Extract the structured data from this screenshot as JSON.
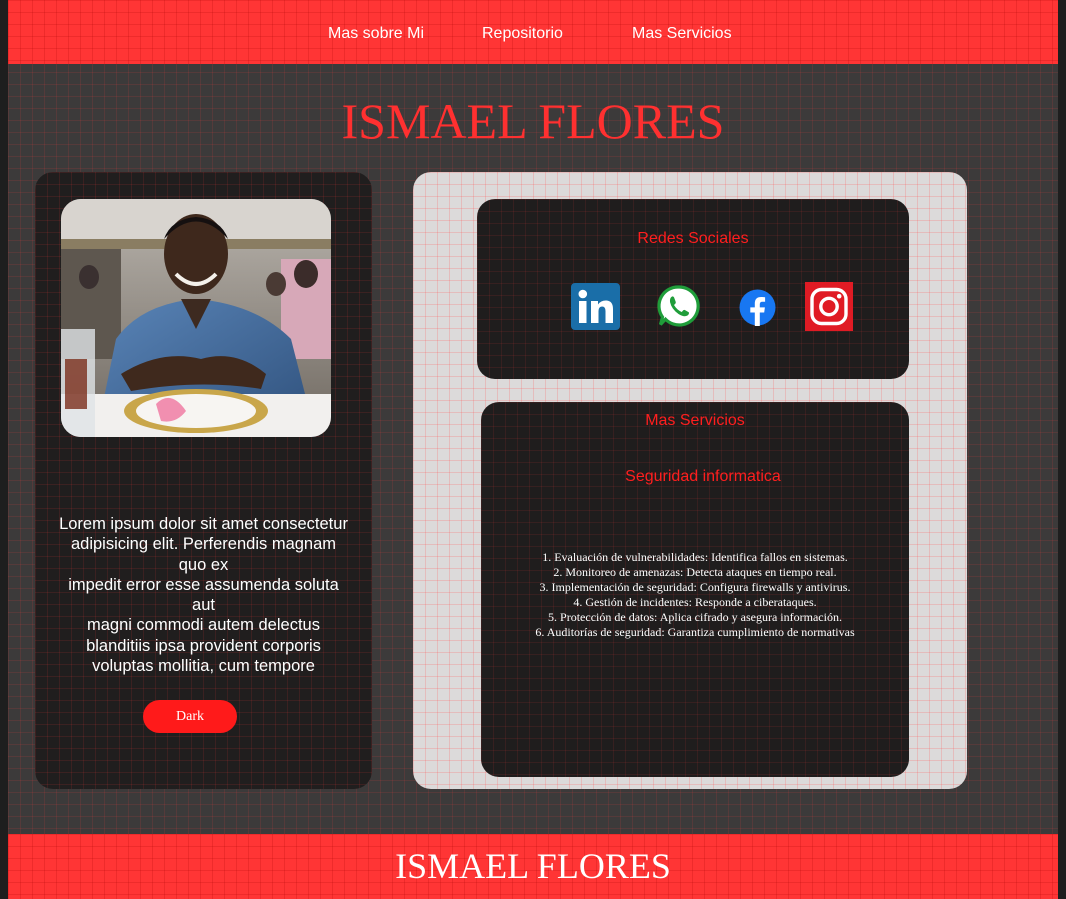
{
  "colors": {
    "accent": "#ff3535",
    "title_red": "#ff3030",
    "page_background": "#3c3a3a",
    "card_dark": "#201e1e",
    "panel_light": "#dcdada",
    "button_red": "#ff1a1a"
  },
  "nav": {
    "items": [
      {
        "label": "Mas sobre Mi"
      },
      {
        "label": "Repositorio"
      },
      {
        "label": "Mas Servicios"
      }
    ]
  },
  "header": {
    "title": "ISMAEL FLORES"
  },
  "profile": {
    "photo_icon": "profile-photo",
    "bio_lines": [
      "Lorem ipsum dolor sit amet consectetur",
      "adipisicing elit. Perferendis magnam",
      "quo ex",
      "impedit error esse assumenda soluta",
      "aut",
      "magni commodi autem delectus",
      "blanditiis ipsa provident corporis",
      "voluptas mollitia, cum tempore"
    ],
    "theme_button_label": "Dark"
  },
  "social": {
    "heading": "Redes Sociales",
    "icons": [
      "linkedin-icon",
      "whatsapp-icon",
      "facebook-icon",
      "instagram-icon"
    ]
  },
  "services": {
    "heading": "Mas Servicios",
    "subheading": "Seguridad informatica",
    "items": [
      "1. Evaluación de vulnerabilidades: Identifica fallos en sistemas.",
      "2. Monitoreo de amenazas: Detecta ataques en tiempo real.",
      "3. Implementación de seguridad: Configura firewalls y antivirus.",
      "4. Gestión de incidentes: Responde a ciberataques.",
      "5. Protección de datos: Aplica cifrado y asegura información.",
      "6. Auditorías de seguridad: Garantiza cumplimiento de normativas"
    ]
  },
  "footer": {
    "title": "ISMAEL FLORES"
  }
}
